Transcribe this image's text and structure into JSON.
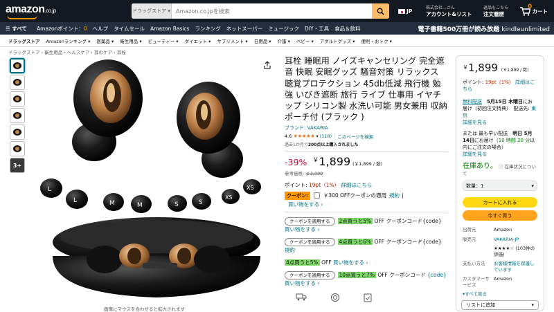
{
  "header": {
    "logo_text": "amazon",
    "logo_tld": ".co.jp",
    "search_category": "ドラッグストア",
    "search_placeholder": "Amazon.co.jpを検索",
    "language": "JP",
    "account_small": "株式会社...さん",
    "account_big": "アカウント&リスト",
    "orders_small": "返品もこちら",
    "orders_big": "注文履歴",
    "cart_count": "0",
    "cart_label": "カート"
  },
  "nav": {
    "all": "すべて",
    "points_label": "Amazonポイント：",
    "points_value": "0",
    "items": [
      "ヘルプ",
      "タイムセール",
      "Amazon Basics",
      "ランキング",
      "ネットスーパー",
      "ミュージック",
      "DIY・工具",
      "食品＆飲料"
    ],
    "promo": "電子書籍500万冊が読み放題",
    "promo_brand": "kindleunlimited"
  },
  "subnav": [
    "ドラッグストア",
    "Amazonランキング",
    "医薬品",
    "衛生用品",
    "ビューティー",
    "ダイエット",
    "サプリメント",
    "日用品",
    "介護",
    "ベビー",
    "アダルトグッズ",
    "便利・おトク"
  ],
  "breadcrumbs": [
    "ドラッグストア",
    "衛生用品・ヘルスケア",
    "耳のケア",
    "耳栓"
  ],
  "gallery": {
    "more": "3+",
    "caption": "画像にマウスを合わせると拡大されます",
    "tip_labels": [
      "L",
      "L",
      "M",
      "M",
      "S",
      "S",
      "XS",
      "XS"
    ]
  },
  "product": {
    "title": "耳栓 睡眠用 ノイズキャンセリング 完全遮音 快眠 安眠グッズ 騒音対策 リラックス 聴覚プロテクション 45db低減 飛行機 勉強 いびき遮断 旅行 ライブ 仕事用 イヤチップ シリコン製 水洗い可能 男女兼用 収納ポーチ付 (ブラック )",
    "brand": "ブランド: VAKARIA",
    "rating": "4.6",
    "review_count": "(118)",
    "search_page": "このページを検索",
    "sold_prefix": "過去1か月で",
    "sold_count": "200点以上購入されました",
    "discount": "-39%",
    "price_yen": "￥",
    "price": "1,899",
    "unit_price": "(￥1,899 / 数)",
    "ref_label": "参考価格:",
    "ref_price": "￥3,099",
    "points_label": "ポイント:",
    "points_value": "19pt（1%）",
    "points_link": "詳細はこちら",
    "coupon_badge": "クーポン:",
    "coupon_text": "￥300 OFFクーポンの適用",
    "coupon_terms": "規約",
    "coupon_sep": "|",
    "buy_more": "買い物をする ›"
  },
  "promos": [
    {
      "button": "クーポンを適用する",
      "highlight": "2点買うと5%",
      "rest": "OFF クーポンコード{code}",
      "link": "買い物をする ›"
    },
    {
      "button": "クーポンを適用する",
      "highlight": "4点買うと6%",
      "rest": "OFF クーポンコード{code}",
      "link": "規約"
    },
    {
      "button": "",
      "highlight": "4点買うと5%",
      "rest": "OFF",
      "link": "買い物をする ›"
    },
    {
      "button": "クーポンを適用する",
      "highlight": "10点買うと7%",
      "rest": "OFF クーポンコード",
      "link": "{code} 買い物をする ›"
    }
  ],
  "buybox": {
    "price_yen": "￥",
    "price": "1,899",
    "unit": "(￥1,899 / 数)",
    "points_label": "ポイント:",
    "points_value": "19pt（1%）",
    "points_link": "詳細はこちら",
    "delivery_link": "無料配送",
    "delivery_date": "5月15日 木曜日",
    "delivery_rest": "にお届け（初回注文特典）　配送先:",
    "delivery_place": "東京",
    "details_link": "詳細を見る",
    "fast_prefix": "または 最も早い配送",
    "fast_date": "明日 5月14日",
    "fast_mid": "にお届け（",
    "fast_time": "10 時間 20 分",
    "fast_rest": "以内にご注文の場合）",
    "stock": "在庫あり。",
    "stock_note": "在庫状況について",
    "qty_label": "数量：1",
    "add_to_cart": "カートに入れる",
    "buy_now": "今すぐ買う",
    "ship_from_k": "出荷元",
    "ship_from_v": "Amazon",
    "seller_k": "販売元",
    "seller_v": "VAKARIA-JP",
    "seller_reviews": "★★★★☆ (103件の評価)",
    "payment_k": "支払い方法",
    "payment_v": "お客様情報を保護しています",
    "service_k": "カスタマーサービス",
    "service_v": "Amazon",
    "more_link": "▾すべて見る",
    "list_label": "リストに追加"
  }
}
